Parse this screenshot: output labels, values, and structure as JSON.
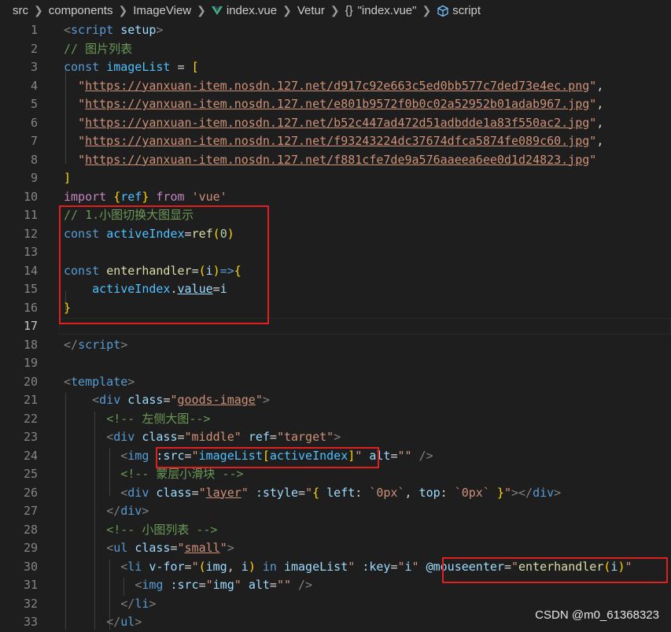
{
  "breadcrumb": {
    "items": [
      "src",
      "components",
      "ImageView",
      "index.vue",
      "Vetur",
      "\"index.vue\"",
      "script"
    ],
    "braces_icon": "{}"
  },
  "editor": {
    "active_line": 17,
    "lines": [
      {
        "n": 1,
        "tokens": [
          [
            "t-tag",
            "<"
          ],
          [
            "t-name",
            "script"
          ],
          [
            "",
            " "
          ],
          [
            "t-attr",
            "setup"
          ],
          [
            "t-tag",
            ">"
          ]
        ]
      },
      {
        "n": 2,
        "tokens": [
          [
            "t-com",
            "// 图片列表"
          ]
        ]
      },
      {
        "n": 3,
        "tokens": [
          [
            "t-kw",
            "const"
          ],
          [
            "",
            " "
          ],
          [
            "t-var",
            "imageList"
          ],
          [
            "",
            " = "
          ],
          [
            "t-br1",
            "["
          ]
        ]
      },
      {
        "n": 4,
        "tokens": [
          [
            "",
            "  "
          ],
          [
            "t-str",
            "\""
          ],
          [
            "t-link",
            "https://yanxuan-item.nosdn.127.net/d917c92e663c5ed0bb577c7ded73e4ec.png"
          ],
          [
            "t-str",
            "\""
          ],
          [
            "",
            ","
          ]
        ]
      },
      {
        "n": 5,
        "tokens": [
          [
            "",
            "  "
          ],
          [
            "t-str",
            "\""
          ],
          [
            "t-link",
            "https://yanxuan-item.nosdn.127.net/e801b9572f0b0c02a52952b01adab967.jpg"
          ],
          [
            "t-str",
            "\""
          ],
          [
            "",
            ","
          ]
        ]
      },
      {
        "n": 6,
        "tokens": [
          [
            "",
            "  "
          ],
          [
            "t-str",
            "\""
          ],
          [
            "t-link",
            "https://yanxuan-item.nosdn.127.net/b52c447ad472d51adbdde1a83f550ac2.jpg"
          ],
          [
            "t-str",
            "\""
          ],
          [
            "",
            ","
          ]
        ]
      },
      {
        "n": 7,
        "tokens": [
          [
            "",
            "  "
          ],
          [
            "t-str",
            "\""
          ],
          [
            "t-link",
            "https://yanxuan-item.nosdn.127.net/f93243224dc37674dfca5874fe089c60.jpg"
          ],
          [
            "t-str",
            "\""
          ],
          [
            "",
            ","
          ]
        ]
      },
      {
        "n": 8,
        "tokens": [
          [
            "",
            "  "
          ],
          [
            "t-str",
            "\""
          ],
          [
            "t-link",
            "https://yanxuan-item.nosdn.127.net/f881cfe7de9a576aaeea6ee0d1d24823.jpg"
          ],
          [
            "t-str",
            "\""
          ]
        ]
      },
      {
        "n": 9,
        "tokens": [
          [
            "t-br1",
            "]"
          ]
        ]
      },
      {
        "n": 10,
        "tokens": [
          [
            "t-ctl",
            "import"
          ],
          [
            "",
            " "
          ],
          [
            "t-br1",
            "{"
          ],
          [
            "t-var",
            "ref"
          ],
          [
            "t-br1",
            "}"
          ],
          [
            "",
            " "
          ],
          [
            "t-ctl",
            "from"
          ],
          [
            "",
            " "
          ],
          [
            "t-str",
            "'vue'"
          ]
        ]
      },
      {
        "n": 11,
        "tokens": [
          [
            "t-com",
            "// 1.小图切换大图显示"
          ]
        ]
      },
      {
        "n": 12,
        "tokens": [
          [
            "t-kw",
            "const"
          ],
          [
            "",
            " "
          ],
          [
            "t-var",
            "activeIndex"
          ],
          [
            "",
            "="
          ],
          [
            "t-fn",
            "ref"
          ],
          [
            "t-br1",
            "("
          ],
          [
            "t-num",
            "0"
          ],
          [
            "t-br1",
            ")"
          ]
        ]
      },
      {
        "n": 13,
        "tokens": []
      },
      {
        "n": 14,
        "tokens": [
          [
            "t-kw",
            "const"
          ],
          [
            "",
            " "
          ],
          [
            "t-fn",
            "enterhandler"
          ],
          [
            "",
            "="
          ],
          [
            "t-br1",
            "("
          ],
          [
            "t-attr",
            "i"
          ],
          [
            "t-br1",
            ")"
          ],
          [
            "t-kw",
            "=>"
          ],
          [
            "t-br1",
            "{"
          ]
        ]
      },
      {
        "n": 15,
        "tokens": [
          [
            "",
            "    "
          ],
          [
            "t-var",
            "activeIndex"
          ],
          [
            "",
            "."
          ],
          [
            "t-attr t-ul",
            "value"
          ],
          [
            "",
            "="
          ],
          [
            "t-attr",
            "i"
          ]
        ]
      },
      {
        "n": 16,
        "tokens": [
          [
            "t-br1",
            "}"
          ]
        ]
      },
      {
        "n": 17,
        "tokens": []
      },
      {
        "n": 18,
        "tokens": [
          [
            "t-tag",
            "</"
          ],
          [
            "t-name",
            "script"
          ],
          [
            "t-tag",
            ">"
          ]
        ]
      },
      {
        "n": 19,
        "tokens": []
      },
      {
        "n": 20,
        "tokens": [
          [
            "t-tag",
            "<"
          ],
          [
            "t-name",
            "template"
          ],
          [
            "t-tag",
            ">"
          ]
        ]
      },
      {
        "n": 21,
        "tokens": [
          [
            "",
            "    "
          ],
          [
            "t-tag",
            "<"
          ],
          [
            "t-name",
            "div"
          ],
          [
            "",
            " "
          ],
          [
            "t-attr",
            "class"
          ],
          [
            "",
            "="
          ],
          [
            "t-str",
            "\""
          ],
          [
            "t-str t-ul",
            "goods-image"
          ],
          [
            "t-str",
            "\""
          ],
          [
            "t-tag",
            ">"
          ]
        ]
      },
      {
        "n": 22,
        "tokens": [
          [
            "",
            "      "
          ],
          [
            "t-com",
            "<!-- 左侧大图-->"
          ]
        ]
      },
      {
        "n": 23,
        "tokens": [
          [
            "",
            "      "
          ],
          [
            "t-tag",
            "<"
          ],
          [
            "t-name",
            "div"
          ],
          [
            "",
            " "
          ],
          [
            "t-attr",
            "class"
          ],
          [
            "",
            "="
          ],
          [
            "t-str",
            "\"middle\""
          ],
          [
            "",
            " "
          ],
          [
            "t-attr",
            "ref"
          ],
          [
            "",
            "="
          ],
          [
            "t-str",
            "\"target\""
          ],
          [
            "t-tag",
            ">"
          ]
        ]
      },
      {
        "n": 24,
        "tokens": [
          [
            "",
            "        "
          ],
          [
            "t-tag",
            "<"
          ],
          [
            "t-name",
            "img"
          ],
          [
            "",
            " "
          ],
          [
            "t-attr",
            ":src"
          ],
          [
            "",
            "="
          ],
          [
            "t-str",
            "\""
          ],
          [
            "t-var",
            "imageList"
          ],
          [
            "t-br1",
            "["
          ],
          [
            "t-var",
            "activeIndex"
          ],
          [
            "t-br1",
            "]"
          ],
          [
            "t-str",
            "\""
          ],
          [
            "",
            " "
          ],
          [
            "t-attr",
            "alt"
          ],
          [
            "",
            "="
          ],
          [
            "t-str",
            "\"\""
          ],
          [
            "",
            " "
          ],
          [
            "t-tag",
            "/>"
          ]
        ]
      },
      {
        "n": 25,
        "tokens": [
          [
            "",
            "        "
          ],
          [
            "t-com",
            "<!-- 蒙层小滑块 -->"
          ]
        ]
      },
      {
        "n": 26,
        "tokens": [
          [
            "",
            "        "
          ],
          [
            "t-tag",
            "<"
          ],
          [
            "t-name",
            "div"
          ],
          [
            "",
            " "
          ],
          [
            "t-attr",
            "class"
          ],
          [
            "",
            "="
          ],
          [
            "t-str",
            "\""
          ],
          [
            "t-str t-ul",
            "layer"
          ],
          [
            "t-str",
            "\""
          ],
          [
            "",
            " "
          ],
          [
            "t-attr",
            ":style"
          ],
          [
            "",
            "="
          ],
          [
            "t-str",
            "\""
          ],
          [
            "t-br1",
            "{"
          ],
          [
            "",
            " "
          ],
          [
            "t-attr",
            "left"
          ],
          [
            "",
            ": "
          ],
          [
            "t-str",
            "`0px`"
          ],
          [
            "",
            ", "
          ],
          [
            "t-attr",
            "top"
          ],
          [
            "",
            ": "
          ],
          [
            "t-str",
            "`0px`"
          ],
          [
            "",
            " "
          ],
          [
            "t-br1",
            "}"
          ],
          [
            "t-str",
            "\""
          ],
          [
            "t-tag",
            "></"
          ],
          [
            "t-name",
            "div"
          ],
          [
            "t-tag",
            ">"
          ]
        ]
      },
      {
        "n": 27,
        "tokens": [
          [
            "",
            "      "
          ],
          [
            "t-tag",
            "</"
          ],
          [
            "t-name",
            "div"
          ],
          [
            "t-tag",
            ">"
          ]
        ]
      },
      {
        "n": 28,
        "tokens": [
          [
            "",
            "      "
          ],
          [
            "t-com",
            "<!-- 小图列表 -->"
          ]
        ]
      },
      {
        "n": 29,
        "tokens": [
          [
            "",
            "      "
          ],
          [
            "t-tag",
            "<"
          ],
          [
            "t-name",
            "ul"
          ],
          [
            "",
            " "
          ],
          [
            "t-attr",
            "class"
          ],
          [
            "",
            "="
          ],
          [
            "t-str",
            "\""
          ],
          [
            "t-str t-ul",
            "small"
          ],
          [
            "t-str",
            "\""
          ],
          [
            "t-tag",
            ">"
          ]
        ]
      },
      {
        "n": 30,
        "tokens": [
          [
            "",
            "        "
          ],
          [
            "t-tag",
            "<"
          ],
          [
            "t-name",
            "li"
          ],
          [
            "",
            " "
          ],
          [
            "t-attr",
            "v-for"
          ],
          [
            "",
            "="
          ],
          [
            "t-str",
            "\""
          ],
          [
            "t-br1",
            "("
          ],
          [
            "t-attr",
            "img"
          ],
          [
            "",
            ", "
          ],
          [
            "t-attr",
            "i"
          ],
          [
            "t-br1",
            ")"
          ],
          [
            "",
            " "
          ],
          [
            "t-kw",
            "in"
          ],
          [
            "",
            " "
          ],
          [
            "t-attr",
            "imageList"
          ],
          [
            "t-str",
            "\""
          ],
          [
            "",
            " "
          ],
          [
            "t-attr",
            ":key"
          ],
          [
            "",
            "="
          ],
          [
            "t-str",
            "\""
          ],
          [
            "t-attr",
            "i"
          ],
          [
            "t-str",
            "\""
          ],
          [
            "",
            " "
          ],
          [
            "t-attr",
            "@mouseenter"
          ],
          [
            "",
            "="
          ],
          [
            "t-str",
            "\""
          ],
          [
            "t-fn",
            "enterhandler"
          ],
          [
            "t-br1",
            "("
          ],
          [
            "t-attr",
            "i"
          ],
          [
            "t-br1",
            ")"
          ],
          [
            "t-str",
            "\""
          ]
        ]
      },
      {
        "n": 31,
        "tokens": [
          [
            "",
            "          "
          ],
          [
            "t-tag",
            "<"
          ],
          [
            "t-name",
            "img"
          ],
          [
            "",
            " "
          ],
          [
            "t-attr",
            ":src"
          ],
          [
            "",
            "="
          ],
          [
            "t-str",
            "\""
          ],
          [
            "t-attr",
            "img"
          ],
          [
            "t-str",
            "\""
          ],
          [
            "",
            " "
          ],
          [
            "t-attr",
            "alt"
          ],
          [
            "",
            "="
          ],
          [
            "t-str",
            "\"\""
          ],
          [
            "",
            " "
          ],
          [
            "t-tag",
            "/>"
          ]
        ]
      },
      {
        "n": 32,
        "tokens": [
          [
            "",
            "        "
          ],
          [
            "t-tag",
            "</"
          ],
          [
            "t-name",
            "li"
          ],
          [
            "t-tag",
            ">"
          ]
        ]
      },
      {
        "n": 33,
        "tokens": [
          [
            "",
            "      "
          ],
          [
            "t-tag",
            "</"
          ],
          [
            "t-name",
            "ul"
          ],
          [
            "t-tag",
            ">"
          ]
        ]
      }
    ]
  },
  "watermark": "CSDN @m0_61368323",
  "colors": {
    "background": "#1e1e1e",
    "line_number": "#858585",
    "highlight_box": "#e02020"
  }
}
